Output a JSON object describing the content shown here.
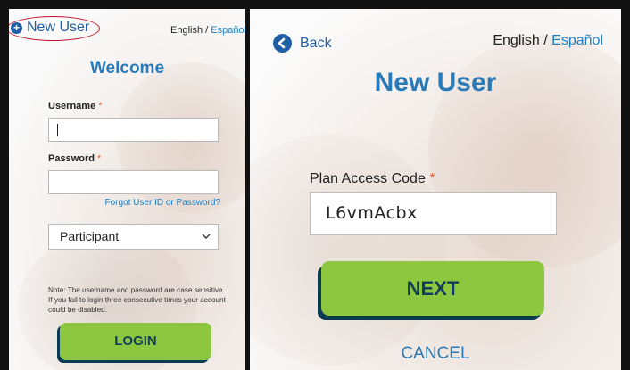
{
  "left_panel": {
    "new_user_link": "New User",
    "lang_english": "English",
    "lang_separator": " / ",
    "lang_spanish": "Español",
    "welcome": "Welcome",
    "username_label": "Username",
    "username_value": "",
    "password_label": "Password",
    "password_value": "",
    "required_mark": "*",
    "forgot_link": "Forgot User ID or Password?",
    "role_select": {
      "selected": "Participant"
    },
    "note": "Note: The username and password are case sensitive. If you fail to login three consecutive times your account could be disabled.",
    "login_button": "LOGIN"
  },
  "right_panel": {
    "back_label": "Back",
    "lang_english": "English",
    "lang_separator": " / ",
    "lang_spanish": "Español",
    "title": "New User",
    "plan_access_label": "Plan Access Code",
    "required_mark": "*",
    "plan_access_value": "L6vmAcbx",
    "next_button": "NEXT",
    "cancel_link": "CANCEL"
  },
  "colors": {
    "brand_blue": "#2a7ab8",
    "link_blue": "#1f5fa6",
    "button_green": "#8dc63f",
    "button_shadow": "#0a3b55",
    "required_orange": "#e0623a",
    "annotation_red": "#c0102a"
  },
  "icons": {
    "new_user": "plus-circle-icon",
    "back": "arrow-left-circle-icon",
    "select": "chevron-down-icon"
  }
}
